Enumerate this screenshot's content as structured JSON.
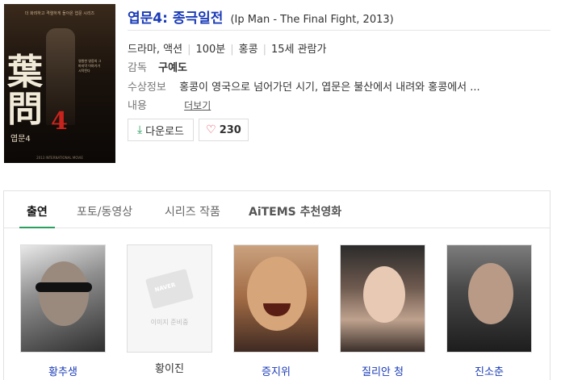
{
  "movie": {
    "title": "엽문4: 종극일전",
    "title_en": "(Ip Man - The Final Fight, 2013)",
    "genre": "드라마, 액션",
    "runtime": "100분",
    "country": "홍콩",
    "rating": "15세 관람가",
    "director_label": "감독",
    "director": "구예도",
    "awards_label": "수상정보",
    "plot_label": "내용",
    "plot": "홍콩이 영국으로 넘어가던 시기, 엽문은 불산에서 내려와 홍콩에서 ...",
    "more_label": "더보기"
  },
  "poster": {
    "tagline_top": "더 화려하고 격렬하게 돌아온 엽문 시리즈",
    "big_text": "葉問",
    "number": "4",
    "sub": "엽문4",
    "tagline_side": "영원한 영웅의 그 마지막 이야기가 시작된다",
    "footer": "2013 INTERNATIONAL MOVIE"
  },
  "actions": {
    "download_label": "다운로드",
    "like_count": "230"
  },
  "tabs": [
    {
      "label": "출연",
      "active": true
    },
    {
      "label": "포토/동영상",
      "active": false
    },
    {
      "label": "시리즈 작품",
      "active": false
    },
    {
      "label": "AiTEMS 추천영화",
      "active": false
    }
  ],
  "cast": [
    {
      "name": "황추생",
      "has_photo": true
    },
    {
      "name": "황이진",
      "has_photo": false,
      "placeholder_brand": "NAVER",
      "placeholder_text": "이미지 준비중"
    },
    {
      "name": "증지위",
      "has_photo": true
    },
    {
      "name": "질리안 청",
      "has_photo": true
    },
    {
      "name": "진소춘",
      "has_photo": true
    }
  ]
}
